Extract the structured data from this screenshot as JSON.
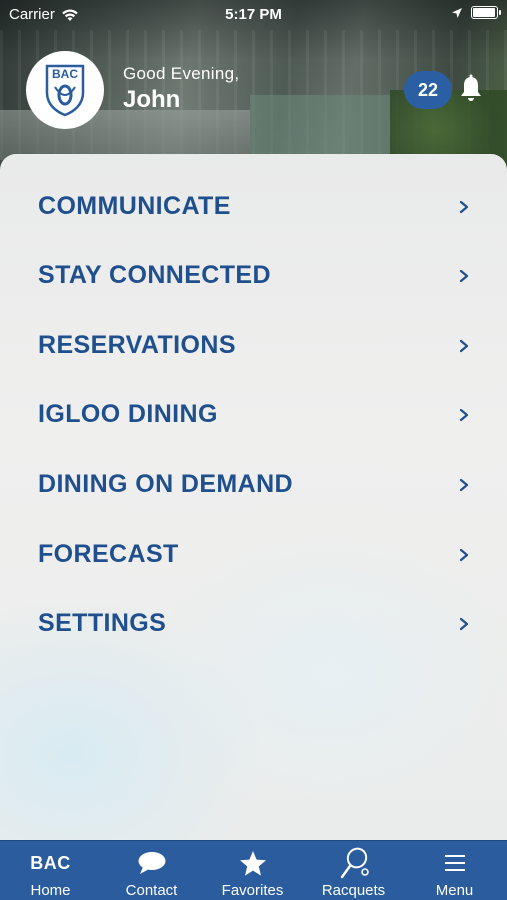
{
  "status_bar": {
    "carrier": "Carrier",
    "time": "5:17 PM"
  },
  "header": {
    "logo_text": "BAC",
    "greeting": "Good Evening,",
    "user_name": "John",
    "notification_count": "22"
  },
  "menu": {
    "items": [
      {
        "label": "COMMUNICATE"
      },
      {
        "label": "STAY CONNECTED"
      },
      {
        "label": "RESERVATIONS"
      },
      {
        "label": "IGLOO DINING"
      },
      {
        "label": "DINING ON DEMAND"
      },
      {
        "label": "FORECAST"
      },
      {
        "label": "SETTINGS"
      }
    ]
  },
  "tab_bar": {
    "tabs": [
      {
        "label": "Home",
        "icon": "bac-logo-icon"
      },
      {
        "label": "Contact",
        "icon": "chat-bubble-icon"
      },
      {
        "label": "Favorites",
        "icon": "star-icon"
      },
      {
        "label": "Racquets",
        "icon": "racquet-icon"
      },
      {
        "label": "Menu",
        "icon": "hamburger-icon"
      }
    ]
  },
  "colors": {
    "brand_blue": "#2a5c9e",
    "menu_text": "#1f4f8c",
    "badge": "#2b5fa3"
  }
}
